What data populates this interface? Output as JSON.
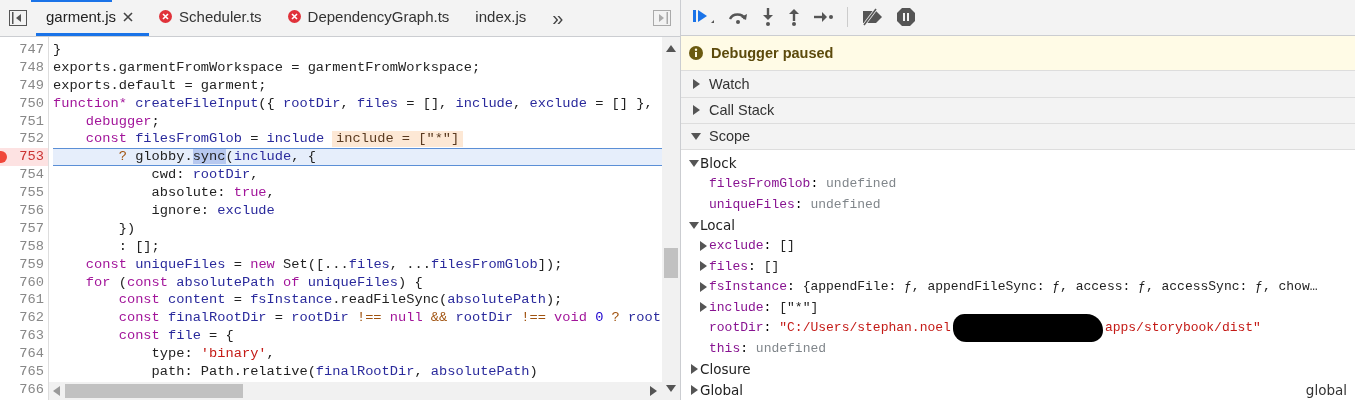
{
  "editor": {
    "tabs": [
      {
        "label": "garment.js",
        "selected": true,
        "error": false,
        "closable": true
      },
      {
        "label": "Scheduler.ts",
        "selected": false,
        "error": true,
        "closable": false
      },
      {
        "label": "DependencyGraph.ts",
        "selected": false,
        "error": true,
        "closable": false
      },
      {
        "label": "index.js",
        "selected": false,
        "error": false,
        "closable": false
      }
    ],
    "more": "»",
    "lines": [
      {
        "number": "747",
        "breakpoint": false,
        "current": false,
        "tokens": [
          {
            "text": "}",
            "kind": "plain"
          }
        ]
      },
      {
        "number": "748",
        "breakpoint": false,
        "current": false,
        "tokens": [
          {
            "text": "exports.garmentFromWorkspace = garmentFromWorkspace;",
            "kind": "plain"
          }
        ]
      },
      {
        "number": "749",
        "breakpoint": false,
        "current": false,
        "tokens": [
          {
            "text": "exports.default = garment;",
            "kind": "plain"
          }
        ]
      },
      {
        "number": "750",
        "breakpoint": false,
        "current": false,
        "tokens": [
          {
            "text": "function*",
            "kind": "keyword"
          },
          {
            "text": " createFileInput",
            "kind": "variable"
          },
          {
            "text": "({ ",
            "kind": "plain"
          },
          {
            "text": "rootDir",
            "kind": "variable"
          },
          {
            "text": ", ",
            "kind": "plain"
          },
          {
            "text": "files",
            "kind": "variable"
          },
          {
            "text": " = [], ",
            "kind": "plain"
          },
          {
            "text": "include",
            "kind": "variable"
          },
          {
            "text": ", ",
            "kind": "plain"
          },
          {
            "text": "exclude",
            "kind": "variable"
          },
          {
            "text": " = [] },",
            "kind": "plain"
          }
        ]
      },
      {
        "number": "751",
        "breakpoint": false,
        "current": false,
        "tokens": [
          {
            "text": "    debugger",
            "kind": "keyword"
          },
          {
            "text": ";",
            "kind": "plain"
          }
        ]
      },
      {
        "number": "752",
        "breakpoint": false,
        "current": false,
        "tokens": [
          {
            "text": "    const",
            "kind": "keyword"
          },
          {
            "text": " filesFromGlob",
            "kind": "variable"
          },
          {
            "text": " = ",
            "kind": "plain"
          },
          {
            "text": "include",
            "kind": "variable"
          }
        ],
        "inline_value": "include = [\"*\"]"
      },
      {
        "number": "753",
        "breakpoint": true,
        "current": true,
        "tokens": [
          {
            "text": "        ?",
            "kind": "operator"
          },
          {
            "text": " globby.",
            "kind": "plain"
          },
          {
            "text": "sync",
            "kind": "selection"
          },
          {
            "text": "(",
            "kind": "plain"
          },
          {
            "text": "include",
            "kind": "variable"
          },
          {
            "text": ", {",
            "kind": "plain"
          }
        ]
      },
      {
        "number": "754",
        "breakpoint": false,
        "current": false,
        "tokens": [
          {
            "text": "            cwd: ",
            "kind": "plain"
          },
          {
            "text": "rootDir",
            "kind": "variable"
          },
          {
            "text": ",",
            "kind": "plain"
          }
        ]
      },
      {
        "number": "755",
        "breakpoint": false,
        "current": false,
        "tokens": [
          {
            "text": "            absolute: ",
            "kind": "plain"
          },
          {
            "text": "true",
            "kind": "keyword"
          },
          {
            "text": ",",
            "kind": "plain"
          }
        ]
      },
      {
        "number": "756",
        "breakpoint": false,
        "current": false,
        "tokens": [
          {
            "text": "            ignore: ",
            "kind": "plain"
          },
          {
            "text": "exclude",
            "kind": "variable"
          }
        ]
      },
      {
        "number": "757",
        "breakpoint": false,
        "current": false,
        "tokens": [
          {
            "text": "        })",
            "kind": "plain"
          }
        ]
      },
      {
        "number": "758",
        "breakpoint": false,
        "current": false,
        "tokens": [
          {
            "text": "        : [];",
            "kind": "plain"
          }
        ]
      },
      {
        "number": "759",
        "breakpoint": false,
        "current": false,
        "tokens": [
          {
            "text": "    const",
            "kind": "keyword"
          },
          {
            "text": " uniqueFiles",
            "kind": "variable"
          },
          {
            "text": " = ",
            "kind": "plain"
          },
          {
            "text": "new",
            "kind": "keyword"
          },
          {
            "text": " Set([...",
            "kind": "plain"
          },
          {
            "text": "files",
            "kind": "variable"
          },
          {
            "text": ", ...",
            "kind": "plain"
          },
          {
            "text": "filesFromGlob",
            "kind": "variable"
          },
          {
            "text": "]);",
            "kind": "plain"
          }
        ]
      },
      {
        "number": "760",
        "breakpoint": false,
        "current": false,
        "tokens": [
          {
            "text": "    for",
            "kind": "keyword"
          },
          {
            "text": " (",
            "kind": "plain"
          },
          {
            "text": "const",
            "kind": "keyword"
          },
          {
            "text": " absolutePath",
            "kind": "variable"
          },
          {
            "text": " of",
            "kind": "keyword"
          },
          {
            "text": " uniqueFiles",
            "kind": "variable"
          },
          {
            "text": ") {",
            "kind": "plain"
          }
        ]
      },
      {
        "number": "761",
        "breakpoint": false,
        "current": false,
        "tokens": [
          {
            "text": "        const",
            "kind": "keyword"
          },
          {
            "text": " content",
            "kind": "variable"
          },
          {
            "text": " = ",
            "kind": "plain"
          },
          {
            "text": "fsInstance",
            "kind": "variable"
          },
          {
            "text": ".readFileSync(",
            "kind": "plain"
          },
          {
            "text": "absolutePath",
            "kind": "variable"
          },
          {
            "text": ");",
            "kind": "plain"
          }
        ]
      },
      {
        "number": "762",
        "breakpoint": false,
        "current": false,
        "tokens": [
          {
            "text": "        const",
            "kind": "keyword"
          },
          {
            "text": " finalRootDir",
            "kind": "variable"
          },
          {
            "text": " = ",
            "kind": "plain"
          },
          {
            "text": "rootDir",
            "kind": "variable"
          },
          {
            "text": " !==",
            "kind": "operator"
          },
          {
            "text": " null",
            "kind": "keyword"
          },
          {
            "text": " &&",
            "kind": "operator"
          },
          {
            "text": " rootDir",
            "kind": "variable"
          },
          {
            "text": " !==",
            "kind": "operator"
          },
          {
            "text": " void",
            "kind": "keyword"
          },
          {
            "text": " 0",
            "kind": "number"
          },
          {
            "text": " ?",
            "kind": "operator"
          },
          {
            "text": " root",
            "kind": "variable"
          }
        ]
      },
      {
        "number": "763",
        "breakpoint": false,
        "current": false,
        "tokens": [
          {
            "text": "        const",
            "kind": "keyword"
          },
          {
            "text": " file",
            "kind": "variable"
          },
          {
            "text": " = {",
            "kind": "plain"
          }
        ]
      },
      {
        "number": "764",
        "breakpoint": false,
        "current": false,
        "tokens": [
          {
            "text": "            type: ",
            "kind": "plain"
          },
          {
            "text": "'binary'",
            "kind": "string"
          },
          {
            "text": ",",
            "kind": "plain"
          }
        ]
      },
      {
        "number": "765",
        "breakpoint": false,
        "current": false,
        "tokens": [
          {
            "text": "            path: Path.relative(",
            "kind": "plain"
          },
          {
            "text": "finalRootDir",
            "kind": "variable"
          },
          {
            "text": ", ",
            "kind": "plain"
          },
          {
            "text": "absolutePath",
            "kind": "variable"
          },
          {
            "text": ")",
            "kind": "plain"
          }
        ]
      },
      {
        "number": "766",
        "breakpoint": false,
        "current": false
      }
    ]
  },
  "debugger": {
    "status": "Debugger paused",
    "sections": [
      {
        "title": "Watch",
        "expanded": false
      },
      {
        "title": "Call Stack",
        "expanded": false
      },
      {
        "title": "Scope",
        "expanded": true,
        "scopes": [
          {
            "name": "Block",
            "expanded": true,
            "vars": [
              {
                "name": "filesFromGlob",
                "separator": ":",
                "value": "undefined",
                "kind": "undefined",
                "expandable": false
              },
              {
                "name": "uniqueFiles",
                "separator": ":",
                "value": "undefined",
                "kind": "undefined",
                "expandable": false
              }
            ]
          },
          {
            "name": "Local",
            "expanded": true,
            "vars": [
              {
                "name": "exclude",
                "separator": ":",
                "value": "[]",
                "kind": "object",
                "expandable": true
              },
              {
                "name": "files",
                "separator": ":",
                "value": "[]",
                "kind": "object",
                "expandable": true
              },
              {
                "name": "fsInstance",
                "separator": ":",
                "value": "{appendFile: ƒ, appendFileSync: ƒ, access: ƒ, accessSync: ƒ, chow…",
                "kind": "object",
                "expandable": true
              },
              {
                "name": "include",
                "separator": ":",
                "value": "[\"*\"]",
                "kind": "object",
                "expandable": true
              },
              {
                "name": "rootDir",
                "separator": ":",
                "value": "\"C:/Users/stephan.noel",
                "value_after_redaction": "apps/storybook/dist\"",
                "redacted": true,
                "kind": "string",
                "expandable": false
              },
              {
                "name": "this",
                "separator": ":",
                "value": "undefined",
                "kind": "undefined",
                "expandable": false
              }
            ]
          },
          {
            "name": "Closure",
            "expanded": false
          },
          {
            "name": "Global",
            "expanded": false,
            "value": "global"
          }
        ]
      }
    ]
  }
}
